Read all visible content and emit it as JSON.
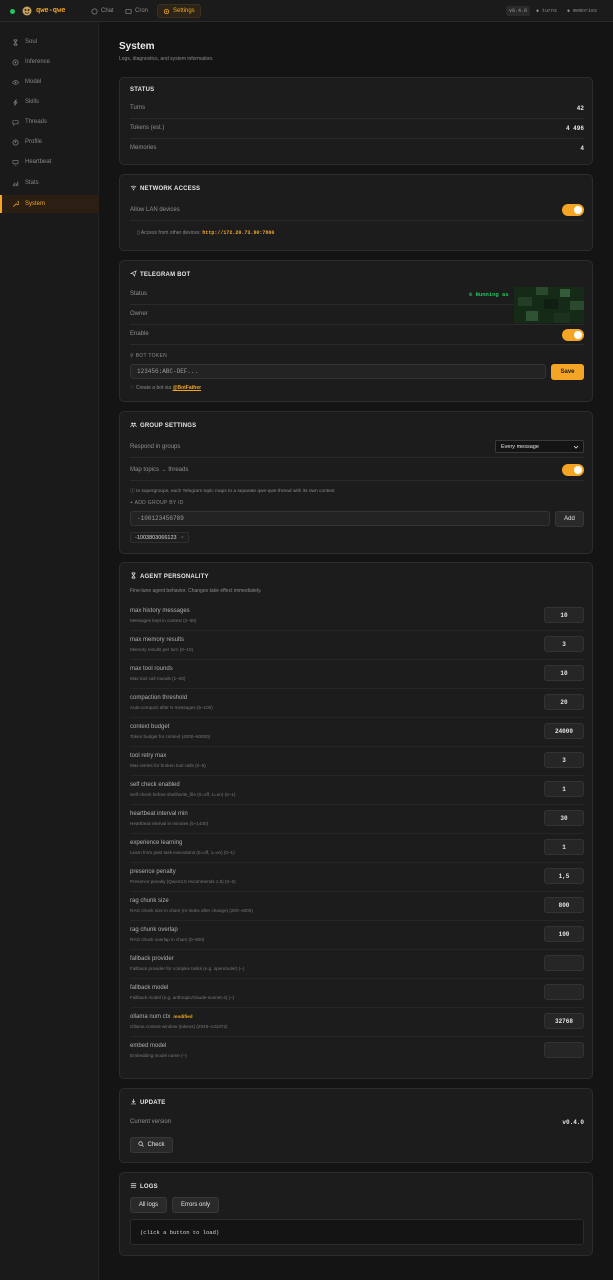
{
  "topbar": {
    "brand": "qwe-qwe",
    "tabs": [
      {
        "label": "Chat",
        "icon": "chat-bubble-icon"
      },
      {
        "label": "Cron",
        "icon": "clock-icon"
      },
      {
        "label": "Settings",
        "icon": "gear-icon"
      }
    ],
    "version": "v0.4.0",
    "turns": "turns",
    "memories": "memories"
  },
  "sidebar": {
    "items": [
      {
        "label": "Soul",
        "icon": "hourglass-icon"
      },
      {
        "label": "Inference",
        "icon": "cpu-icon"
      },
      {
        "label": "Model",
        "icon": "eye-icon"
      },
      {
        "label": "Skills",
        "icon": "lightning-icon"
      },
      {
        "label": "Threads",
        "icon": "threads-icon"
      },
      {
        "label": "Profile",
        "icon": "profile-icon"
      },
      {
        "label": "Heartbeat",
        "icon": "heartbeat-icon"
      },
      {
        "label": "Stats",
        "icon": "bar-chart-icon"
      },
      {
        "label": "System",
        "icon": "wrench-icon"
      }
    ],
    "active": "System"
  },
  "page": {
    "title": "System",
    "subtitle": "Logs, diagnostics, and system information."
  },
  "status": {
    "title": "STATUS",
    "rows": [
      {
        "label": "Turns",
        "value": "42"
      },
      {
        "label": "Tokens (est.)",
        "value": "4 496"
      },
      {
        "label": "Memories",
        "value": "4"
      }
    ]
  },
  "network": {
    "title": "NETWORK ACCESS",
    "allow_label": "Allow LAN devices",
    "access_prefix": "Access from other devices:",
    "access_url": "http://172.20.73.90:7860"
  },
  "telegram": {
    "title": "TELEGRAM BOT",
    "status_label": "Status",
    "status_value": "Running as",
    "owner_label": "Owner",
    "enable_label": "Enable",
    "token_label": "BOT TOKEN",
    "token_placeholder": "123456:ABC-DEF...",
    "save_label": "Save",
    "create_prefix": "Create a bot via",
    "create_link": "@BotFather"
  },
  "groups": {
    "title": "GROUP SETTINGS",
    "respond_label": "Respond in groups",
    "respond_value": "Every message",
    "map_label": "Map topics → threads",
    "map_hint": "In supergroups, each Telegram topic maps to a separate qwe-qwe thread with its own context",
    "add_label": "+ ADD GROUP BY ID",
    "add_placeholder": "-100123456789",
    "add_button": "Add",
    "group_chip": "-1003803066123"
  },
  "agent": {
    "title": "AGENT PERSONALITY",
    "subtitle": "Fine-tune agent behavior. Changes take effect immediately.",
    "params": [
      {
        "name": "max history messages",
        "desc": "Messages kept in context (2–50)",
        "value": "10",
        "modified": ""
      },
      {
        "name": "max memory results",
        "desc": "Memory results per turn (0–10)",
        "value": "3",
        "modified": ""
      },
      {
        "name": "max tool rounds",
        "desc": "Max tool call rounds (1–30)",
        "value": "10",
        "modified": ""
      },
      {
        "name": "compaction threshold",
        "desc": "Auto-compact after N messages (5–100)",
        "value": "20",
        "modified": ""
      },
      {
        "name": "context budget",
        "desc": "Token budget for context (4000–60000)",
        "value": "24000",
        "modified": ""
      },
      {
        "name": "tool retry max",
        "desc": "Max retries for broken tool calls (0–5)",
        "value": "3",
        "modified": ""
      },
      {
        "name": "self check enabled",
        "desc": "Self-check before shell/write_file (0=off, 1=on) (0–1)",
        "value": "1",
        "modified": ""
      },
      {
        "name": "heartbeat interval min",
        "desc": "Heartbeat interval in minutes (5–1440)",
        "value": "30",
        "modified": ""
      },
      {
        "name": "experience learning",
        "desc": "Learn from past task executions (0=off, 1=on) (0–1)",
        "value": "1",
        "modified": ""
      },
      {
        "name": "presence penalty",
        "desc": "Presence penalty (Qwen3.5 recommends 1.5) (0–2)",
        "value": "1,5",
        "modified": ""
      },
      {
        "name": "rag chunk size",
        "desc": "RAG chunk size in chars (re-index after change) (200–4000)",
        "value": "800",
        "modified": ""
      },
      {
        "name": "rag chunk overlap",
        "desc": "RAG chunk overlap in chars (0–500)",
        "value": "100",
        "modified": ""
      },
      {
        "name": "fallback provider",
        "desc": "Fallback provider for complex tasks (e.g. openrouter) (–)",
        "value": "",
        "modified": ""
      },
      {
        "name": "fallback model",
        "desc": "Fallback model (e.g. anthropic/claude-sonnet-4) (–)",
        "value": "",
        "modified": ""
      },
      {
        "name": "ollama num ctx",
        "desc": "Ollama context window (tokens) (2048–131072)",
        "value": "32768",
        "modified": "modified"
      },
      {
        "name": "embed model",
        "desc": "Embedding model name (–)",
        "value": "",
        "modified": ""
      }
    ]
  },
  "update": {
    "title": "UPDATE",
    "current_label": "Current version",
    "current_value": "v0.4.0",
    "check_label": "Check"
  },
  "logs": {
    "title": "LOGS",
    "all_label": "All logs",
    "errors_label": "Errors only",
    "output": "(click a button to load)"
  },
  "colors": {
    "accent": "#f5a524",
    "success": "#22c55e",
    "background": "#141414",
    "card": "#1c1c1c"
  }
}
